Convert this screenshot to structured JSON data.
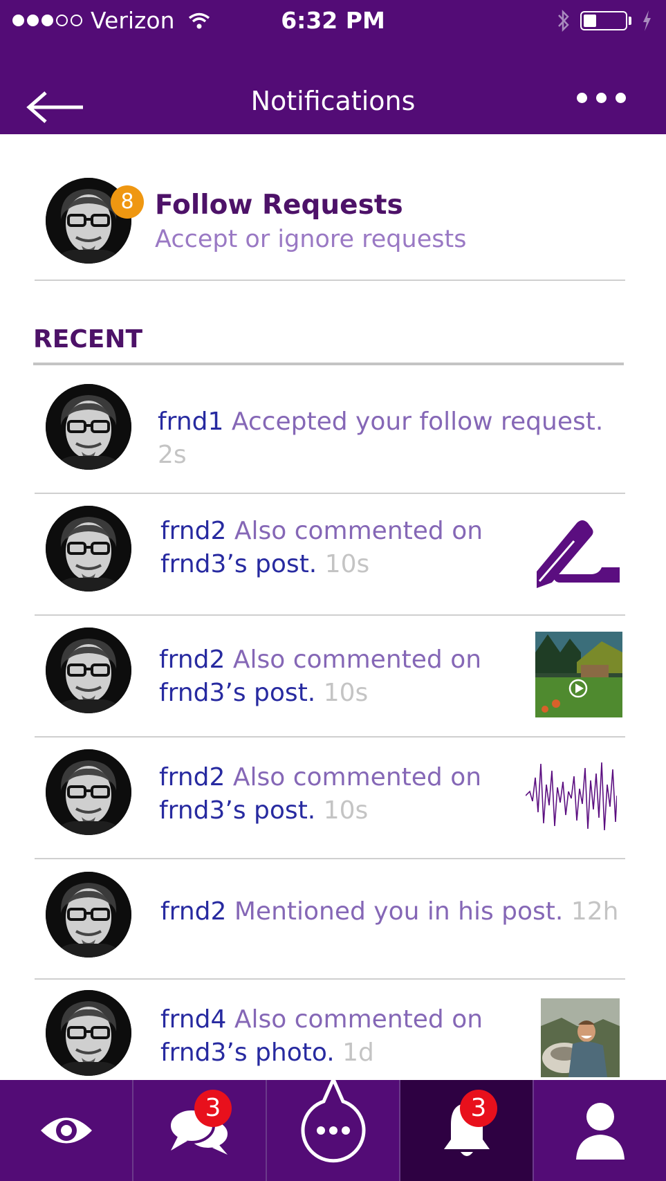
{
  "status_bar": {
    "carrier": "Verizon",
    "time": "6:32 PM"
  },
  "header": {
    "title": "Notifications"
  },
  "follow_requests": {
    "count": "8",
    "title": "Follow Requests",
    "subtitle": "Accept or ignore requests"
  },
  "recent_label": "RECENT",
  "notifications": [
    {
      "user": "frnd1",
      "line1": "Accepted your follow request.",
      "line2": "",
      "time": "2s",
      "thumb": "none"
    },
    {
      "user": "frnd2",
      "line1": "Also commented on",
      "line2": "frnd3’s post.",
      "time": "10s",
      "thumb": "writing-hand-icon"
    },
    {
      "user": "frnd2",
      "line1": "Also commented on",
      "line2": "frnd3’s post.",
      "time": "10s",
      "thumb": "video-thumbnail"
    },
    {
      "user": "frnd2",
      "line1": "Also commented on",
      "line2": "frnd3’s post.",
      "time": "10s",
      "thumb": "audio-waveform"
    },
    {
      "user": "frnd2",
      "line1": "Mentioned you in his post.",
      "line2": "",
      "time": "12h",
      "thumb": "none"
    },
    {
      "user": "frnd4",
      "line1": "Also commented on",
      "line2": "frnd3’s photo.",
      "time": "1d",
      "thumb": "photo-thumbnail"
    }
  ],
  "tabs": [
    {
      "name": "eye-icon",
      "badge": ""
    },
    {
      "name": "chat-bubbles-icon",
      "badge": "3"
    },
    {
      "name": "compose-bubble-icon",
      "badge": ""
    },
    {
      "name": "bell-icon",
      "badge": "3",
      "active": true
    },
    {
      "name": "profile-icon",
      "badge": ""
    }
  ],
  "colors": {
    "brand": "#530c76",
    "accent": "#ef9711",
    "badge": "#e8101c",
    "username": "#272aa0",
    "text": "#8567b6"
  }
}
